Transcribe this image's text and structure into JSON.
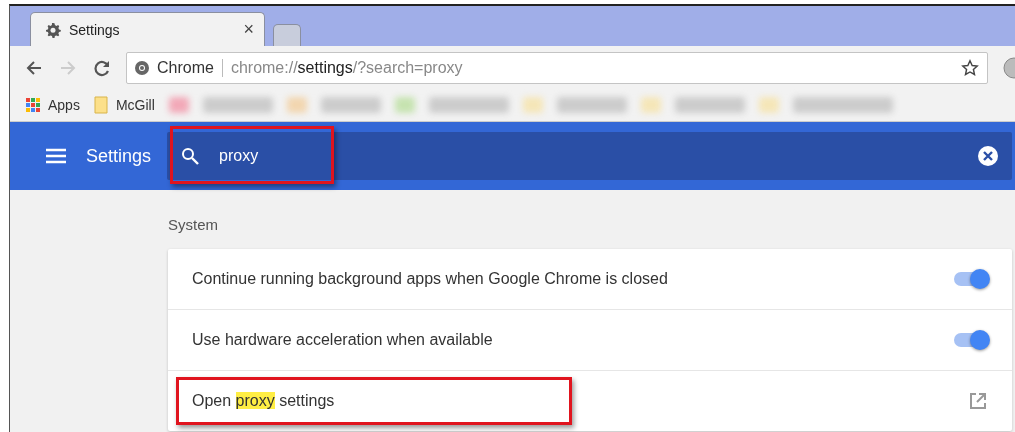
{
  "tabs": [
    {
      "title": "Settings",
      "close": "×",
      "selected": true
    },
    {
      "selected": false
    }
  ],
  "address_bar": {
    "site": "Chrome",
    "url": [
      {
        "text": "chrome://",
        "emphasized": false
      },
      {
        "text": "settings",
        "emphasized": true
      },
      {
        "text": "/?search=proxy",
        "emphasized": false
      }
    ]
  },
  "bookmarks": [
    {
      "label": "Apps",
      "kind": "apps"
    },
    {
      "label": "McGill",
      "kind": "folder"
    }
  ],
  "header": {
    "title": "Settings",
    "search": {
      "value": "proxy",
      "annotated": true
    }
  },
  "section": {
    "title": "System",
    "rows": [
      {
        "kind": "toggle",
        "label": [
          {
            "text": "Continue running background apps when Google Chrome is closed",
            "highlighted": false
          }
        ],
        "on": true,
        "annotated": false
      },
      {
        "kind": "toggle",
        "label": [
          {
            "text": "Use hardware acceleration when available",
            "highlighted": false
          }
        ],
        "on": true,
        "annotated": false
      },
      {
        "kind": "link",
        "label": [
          {
            "text": "Open ",
            "highlighted": false
          },
          {
            "text": "proxy",
            "highlighted": true
          },
          {
            "text": " settings",
            "highlighted": false
          }
        ],
        "annotated": true
      }
    ]
  }
}
